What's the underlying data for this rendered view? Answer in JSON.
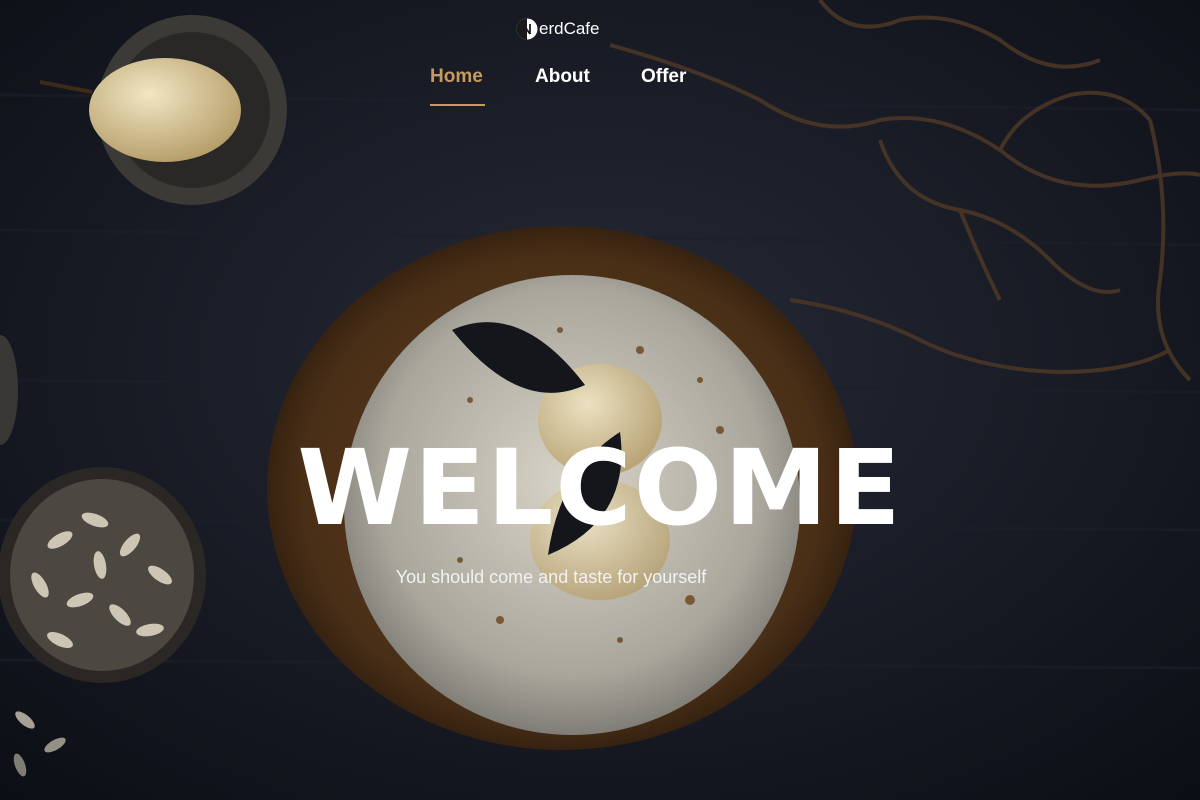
{
  "brand": {
    "logo_text": "erdCafe",
    "logo_icon": "n-circle-logo-icon"
  },
  "nav": {
    "items": [
      {
        "label": "Home",
        "active": true
      },
      {
        "label": "About",
        "active": false
      },
      {
        "label": "Offer",
        "active": false
      }
    ]
  },
  "hero": {
    "title": "WELCOME",
    "subtitle": "You should come and taste for yourself"
  },
  "colors": {
    "accent": "#c79a5d",
    "text": "#ffffff",
    "background": "#12141c"
  }
}
